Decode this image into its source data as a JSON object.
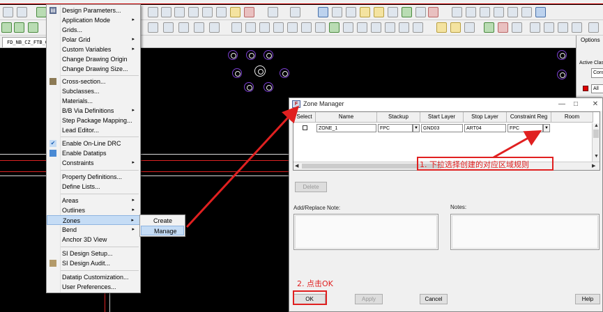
{
  "menu": {
    "items": [
      {
        "label": "Design Parameters...",
        "submenu": false
      },
      {
        "label": "Application Mode",
        "submenu": true
      },
      {
        "label": "Grids...",
        "submenu": false
      },
      {
        "label": "Polar Grid",
        "submenu": true
      },
      {
        "label": "Custom Variables",
        "submenu": true
      },
      {
        "label": "Change Drawing Origin",
        "submenu": false
      },
      {
        "label": "Change Drawing Size...",
        "submenu": false
      },
      {
        "label": "Cross-section...",
        "submenu": false
      },
      {
        "label": "Subclasses...",
        "submenu": false
      },
      {
        "label": "Materials...",
        "submenu": false
      },
      {
        "label": "B/B Via Definitions",
        "submenu": true
      },
      {
        "label": "Step Package Mapping...",
        "submenu": false
      },
      {
        "label": "Lead Editor...",
        "submenu": false
      },
      {
        "label": "Enable On-Line DRC",
        "submenu": false
      },
      {
        "label": "Enable Datatips",
        "submenu": false
      },
      {
        "label": "Constraints",
        "submenu": true
      },
      {
        "label": "Property Definitions...",
        "submenu": false
      },
      {
        "label": "Define Lists...",
        "submenu": false
      },
      {
        "label": "Areas",
        "submenu": true
      },
      {
        "label": "Outlines",
        "submenu": true
      },
      {
        "label": "Zones",
        "submenu": true
      },
      {
        "label": "Bend",
        "submenu": true
      },
      {
        "label": "Anchor 3D View",
        "submenu": false
      },
      {
        "label": "SI Design Setup...",
        "submenu": false
      },
      {
        "label": "SI Design Audit...",
        "submenu": false
      },
      {
        "label": "Datatip Customization...",
        "submenu": false
      },
      {
        "label": "User Preferences...",
        "submenu": false
      }
    ],
    "arrow": "▸",
    "check_mark": "✔"
  },
  "submenu": {
    "create": "Create",
    "manage": "Manage"
  },
  "tab": {
    "file": "FD_NB_CZ_FTB_G"
  },
  "options_panel": {
    "title": "Options",
    "active_class": "Active Clas",
    "combo_value": "Cons",
    "all_value": "All"
  },
  "dialog": {
    "title": "Zone Manager",
    "columns": [
      "Select",
      "Name",
      "Stackup",
      "Start Layer",
      "Stop Layer",
      "Constraint Reg",
      "Room"
    ],
    "row": {
      "name": "ZONE_1",
      "stackup": "FPC",
      "start_layer": "GND03",
      "stop_layer": "ART04",
      "constraint_region": "FPC"
    },
    "delete": "Delete",
    "add_replace_note": "Add/Replace Note:",
    "notes": "Notes:",
    "ok": "OK",
    "apply": "Apply",
    "cancel": "Cancel",
    "help": "Help"
  },
  "annotations": {
    "step1": "1. 下拉选择创建的对应区域规则",
    "step2": "2. 点击OK"
  },
  "colors": {
    "annotation": "#e02020",
    "menu_highlight": "#c5dcf5",
    "via": "#7b3fd1"
  }
}
